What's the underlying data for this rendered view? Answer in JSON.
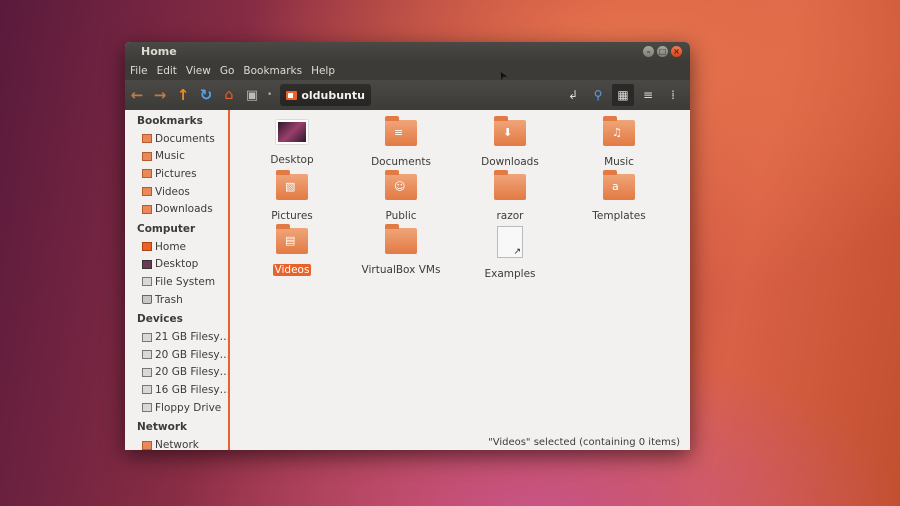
{
  "window": {
    "title": "Home"
  },
  "menubar": [
    "File",
    "Edit",
    "View",
    "Go",
    "Bookmarks",
    "Help"
  ],
  "toolbar": {
    "location": "oldubuntu"
  },
  "sidebar": {
    "bookmarks": {
      "header": "Bookmarks",
      "items": [
        "Documents",
        "Music",
        "Pictures",
        "Videos",
        "Downloads"
      ]
    },
    "computer": {
      "header": "Computer",
      "items": [
        "Home",
        "Desktop",
        "File System",
        "Trash"
      ]
    },
    "devices": {
      "header": "Devices",
      "items": [
        "21 GB Filesy…",
        "20 GB Filesy…",
        "20 GB Filesy…",
        "16 GB Filesy…",
        "Floppy Drive"
      ]
    },
    "network": {
      "header": "Network",
      "items": [
        "Network"
      ]
    }
  },
  "files": [
    {
      "label": "Desktop",
      "icon": "desktop-icon"
    },
    {
      "label": "Documents",
      "icon": "documents-folder-icon"
    },
    {
      "label": "Downloads",
      "icon": "downloads-folder-icon"
    },
    {
      "label": "Music",
      "icon": "music-folder-icon"
    },
    {
      "label": "Pictures",
      "icon": "pictures-folder-icon"
    },
    {
      "label": "Public",
      "icon": "public-folder-icon"
    },
    {
      "label": "razor",
      "icon": "folder-icon"
    },
    {
      "label": "Templates",
      "icon": "templates-folder-icon"
    },
    {
      "label": "Videos",
      "icon": "videos-folder-icon",
      "selected": true
    },
    {
      "label": "VirtualBox VMs",
      "icon": "folder-icon"
    },
    {
      "label": "Examples",
      "icon": "symlink-file-icon"
    }
  ],
  "status": "\"Videos\" selected (containing 0 items)",
  "colors": {
    "accent": "#e9622a",
    "chrome": "#3c3b37"
  }
}
